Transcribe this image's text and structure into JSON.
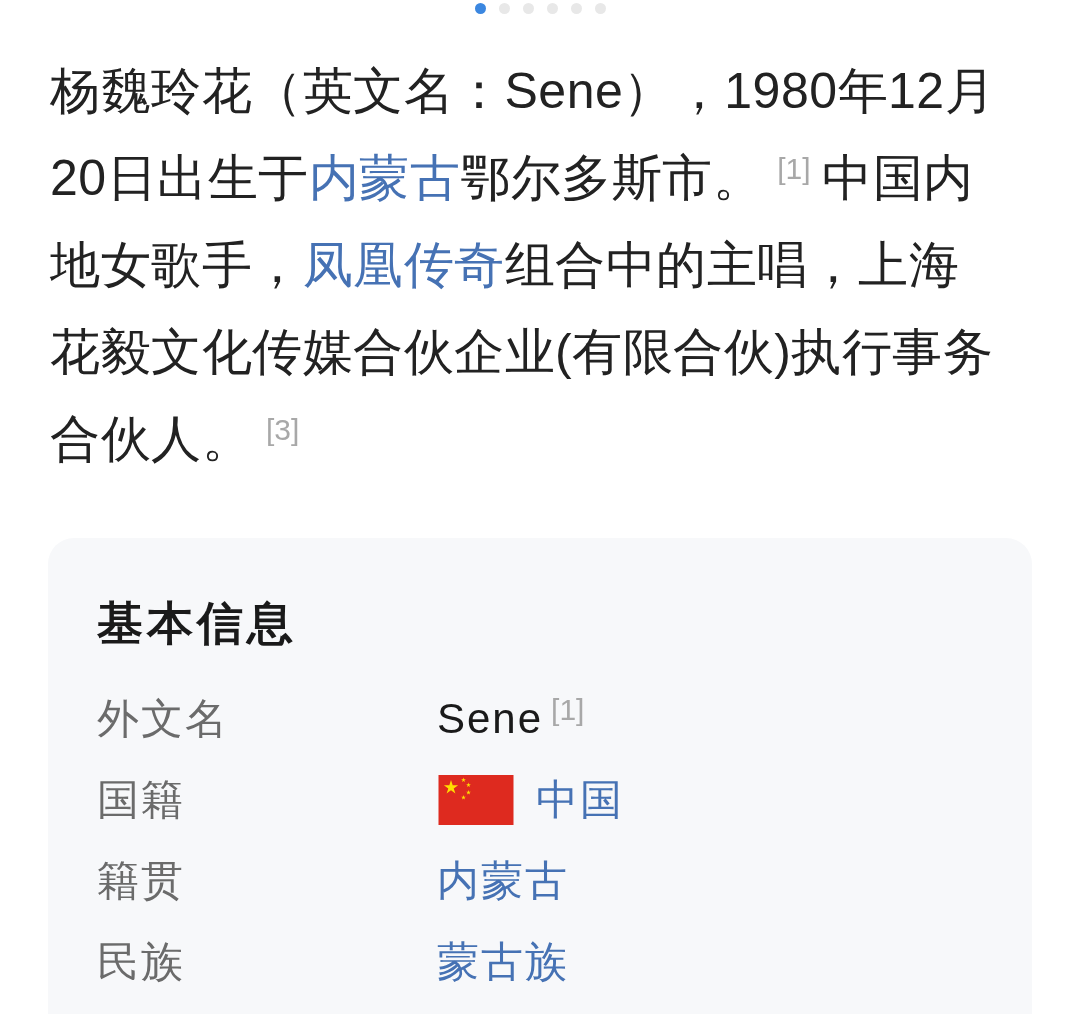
{
  "pager": {
    "dots": [
      {
        "selected": true
      },
      {
        "selected": false
      },
      {
        "selected": false
      },
      {
        "selected": false
      },
      {
        "selected": false
      },
      {
        "selected": false
      }
    ]
  },
  "intro": [
    {
      "kind": "text",
      "text": "杨魏玲花（英文名：Sene），1980年12月20日出生于"
    },
    {
      "kind": "link",
      "text": "内蒙古"
    },
    {
      "kind": "text",
      "text": "鄂尔多斯市。"
    },
    {
      "kind": "ref",
      "text": "[1]"
    },
    {
      "kind": "text",
      "text": "中国内地女歌手，"
    },
    {
      "kind": "link",
      "text": "凤凰传奇"
    },
    {
      "kind": "text",
      "text": "组合中的主唱，上海花毅文化传媒合伙企业(有限合伙)执行事务合伙人。"
    },
    {
      "kind": "ref",
      "text": "[3]"
    }
  ],
  "info_card": {
    "title": "基本信息",
    "rows": [
      {
        "label": "外文名",
        "kind": "text",
        "value": "Sene",
        "ref": "[1]"
      },
      {
        "label": "国籍",
        "kind": "flag_link",
        "value": "中国"
      },
      {
        "label": "籍贯",
        "kind": "link",
        "value": "内蒙古"
      },
      {
        "label": "民族",
        "kind": "link",
        "value": "蒙古族"
      }
    ]
  }
}
